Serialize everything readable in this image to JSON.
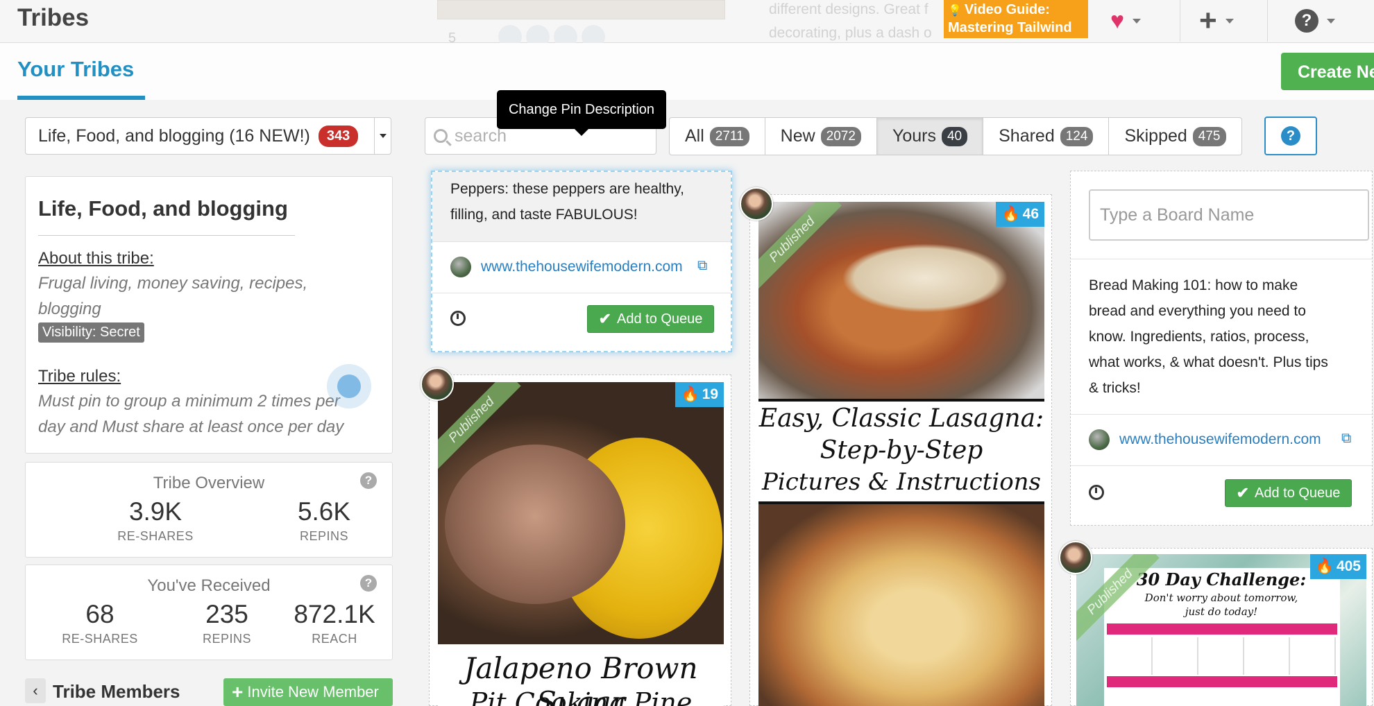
{
  "header": {
    "app_title": "Tribes",
    "video_guide_line1": "Video Guide:",
    "video_guide_line2": "Mastering Tailwind",
    "bg_stat": "5",
    "bg_text_line1": "different designs. Great f",
    "bg_text_line2": "decorating, plus a dash o"
  },
  "tabs": {
    "active": "Your Tribes"
  },
  "create_button": "Create Ne",
  "tribe_select": {
    "label": "Life, Food, and blogging (16 NEW!)",
    "count": "343"
  },
  "search": {
    "placeholder": "search"
  },
  "tooltip": "Change Pin Description",
  "filters": [
    {
      "label": "All",
      "count": "2711"
    },
    {
      "label": "New",
      "count": "2072"
    },
    {
      "label": "Yours",
      "count": "40"
    },
    {
      "label": "Shared",
      "count": "124"
    },
    {
      "label": "Skipped",
      "count": "475"
    }
  ],
  "help_label": "?",
  "tribe_info": {
    "title": "Life, Food, and blogging",
    "about_label": "About this tribe:",
    "about_text": "Frugal living, money saving, recipes, blogging",
    "visibility": "Visibility: Secret",
    "rules_label": "Tribe rules:",
    "rules_text": "Must pin to group a minimum 2 times per day and Must share at least once per day"
  },
  "overview": {
    "title": "Tribe Overview",
    "reshares": "3.9K",
    "reshares_label": "RE-SHARES",
    "repins": "5.6K",
    "repins_label": "REPINS"
  },
  "received": {
    "title": "You've Received",
    "reshares": "68",
    "reshares_label": "RE-SHARES",
    "repins": "235",
    "repins_label": "REPINS",
    "reach": "872.1K",
    "reach_label": "REACH"
  },
  "members": {
    "title": "Tribe Members",
    "invite": "Invite New Member"
  },
  "pins": {
    "peppers": {
      "desc_line1": "Peppers: these peppers are healthy,",
      "desc_line2": "filling, and taste FABULOUS!",
      "site": "www.thehousewifemodern.com",
      "queue": "Add to Queue"
    },
    "jalapeno": {
      "count": "19",
      "published": "Published",
      "title_line1": "Jalapeno Brown Sugar",
      "title_line2": "Pit Cooking Pine"
    },
    "lasagna": {
      "count": "46",
      "published": "Published",
      "title_line1": "Easy, Classic Lasagna:",
      "title_line2": "Step-by-Step",
      "title_line3": "Pictures & Instructions"
    },
    "bread": {
      "board_placeholder": "Type a Board Name",
      "desc_line1": "Bread Making 101: how to make",
      "desc_line2": "bread and everything you need to",
      "desc_line3": "know. Ingredients, ratios, process,",
      "desc_line4": "what works, & what doesn't. Plus tips",
      "desc_line5": "& tricks!",
      "site": "www.thehousewifemodern.com",
      "queue": "Add to Queue"
    },
    "challenge": {
      "count": "405",
      "published": "Published",
      "title": "30 Day Challenge:",
      "subtitle1": "Don't worry about tomorrow,",
      "subtitle2": "just do today!"
    }
  },
  "colors": {
    "accent": "#2390c4",
    "green": "#4aa84f",
    "orange": "#f7a11a",
    "badge_red": "#c9302c",
    "flame_blue": "#2ba6de"
  }
}
